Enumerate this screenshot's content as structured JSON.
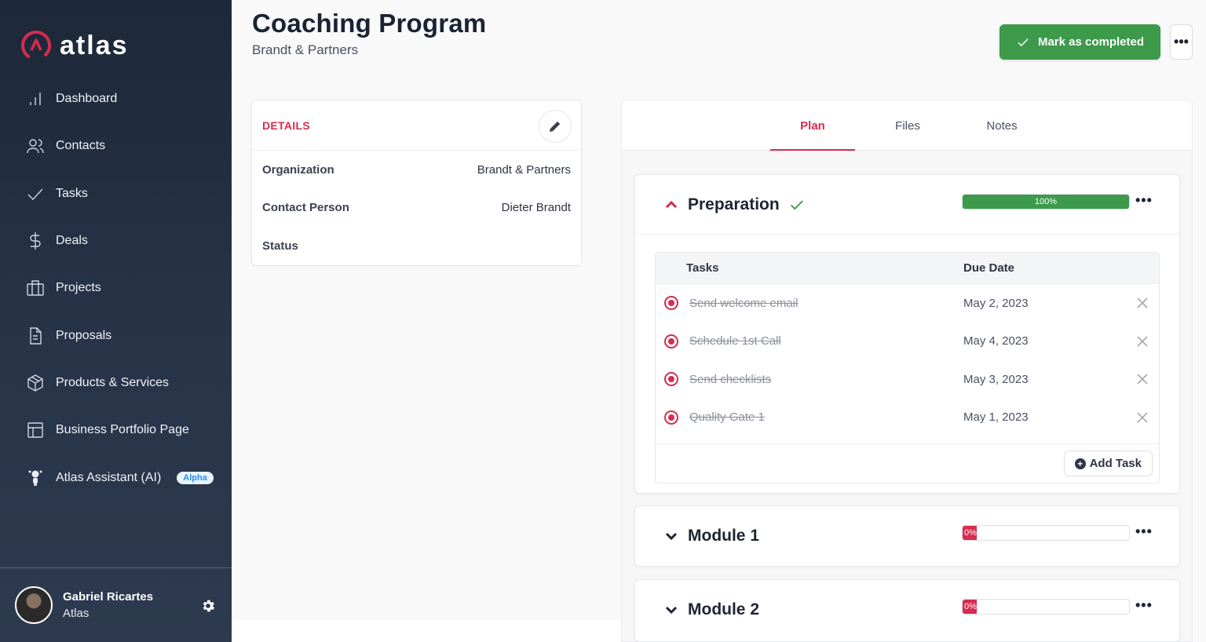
{
  "brand": {
    "name": "atlas",
    "logo_icon": "atlas-logo-icon",
    "accent": "#d62c4e"
  },
  "sidebar": {
    "items": [
      {
        "label": "Dashboard",
        "icon": "bar-chart-icon"
      },
      {
        "label": "Contacts",
        "icon": "users-icon"
      },
      {
        "label": "Tasks",
        "icon": "check-icon"
      },
      {
        "label": "Deals",
        "icon": "dollar-icon"
      },
      {
        "label": "Projects",
        "icon": "briefcase-icon"
      },
      {
        "label": "Proposals",
        "icon": "document-icon"
      },
      {
        "label": "Products & Services",
        "icon": "box-icon"
      },
      {
        "label": "Business Portfolio Page",
        "icon": "layout-icon"
      },
      {
        "label": "Atlas Assistant (AI)",
        "icon": "robot-icon",
        "badge": "Alpha"
      }
    ],
    "user": {
      "name": "Gabriel Ricartes",
      "org": "Atlas"
    }
  },
  "header": {
    "title": "Coaching Program",
    "subtitle": "Brandt & Partners",
    "complete_label": "Mark as completed",
    "complete_color": "#3d9a4b",
    "more_label": "•••"
  },
  "details": {
    "title": "DETAILS",
    "rows": [
      {
        "key": "Organization",
        "value": "Brandt & Partners"
      },
      {
        "key": "Contact Person",
        "value": "Dieter Brandt"
      },
      {
        "key": "Status",
        "value": ""
      }
    ]
  },
  "tabs": [
    {
      "label": "Plan",
      "active": true
    },
    {
      "label": "Files",
      "active": false
    },
    {
      "label": "Notes",
      "active": false
    }
  ],
  "modules": [
    {
      "title": "Preparation",
      "expanded": true,
      "completed": true,
      "progress": 100,
      "progress_label": "100%",
      "table": {
        "col_tasks": "Tasks",
        "col_due": "Due Date",
        "tasks": [
          {
            "name": "Send welcome email",
            "due": "May 2, 2023"
          },
          {
            "name": "Schedule 1st Call",
            "due": "May 4, 2023"
          },
          {
            "name": "Send checklists",
            "due": "May 3, 2023"
          },
          {
            "name": "Quality Gate 1",
            "due": "May 1, 2023"
          }
        ],
        "add_label": "Add Task"
      }
    },
    {
      "title": "Module 1",
      "expanded": false,
      "completed": false,
      "progress": 0,
      "progress_label": "0%"
    },
    {
      "title": "Module 2",
      "expanded": false,
      "completed": false,
      "progress": 0,
      "progress_label": "0%"
    }
  ],
  "more_label": "•••"
}
